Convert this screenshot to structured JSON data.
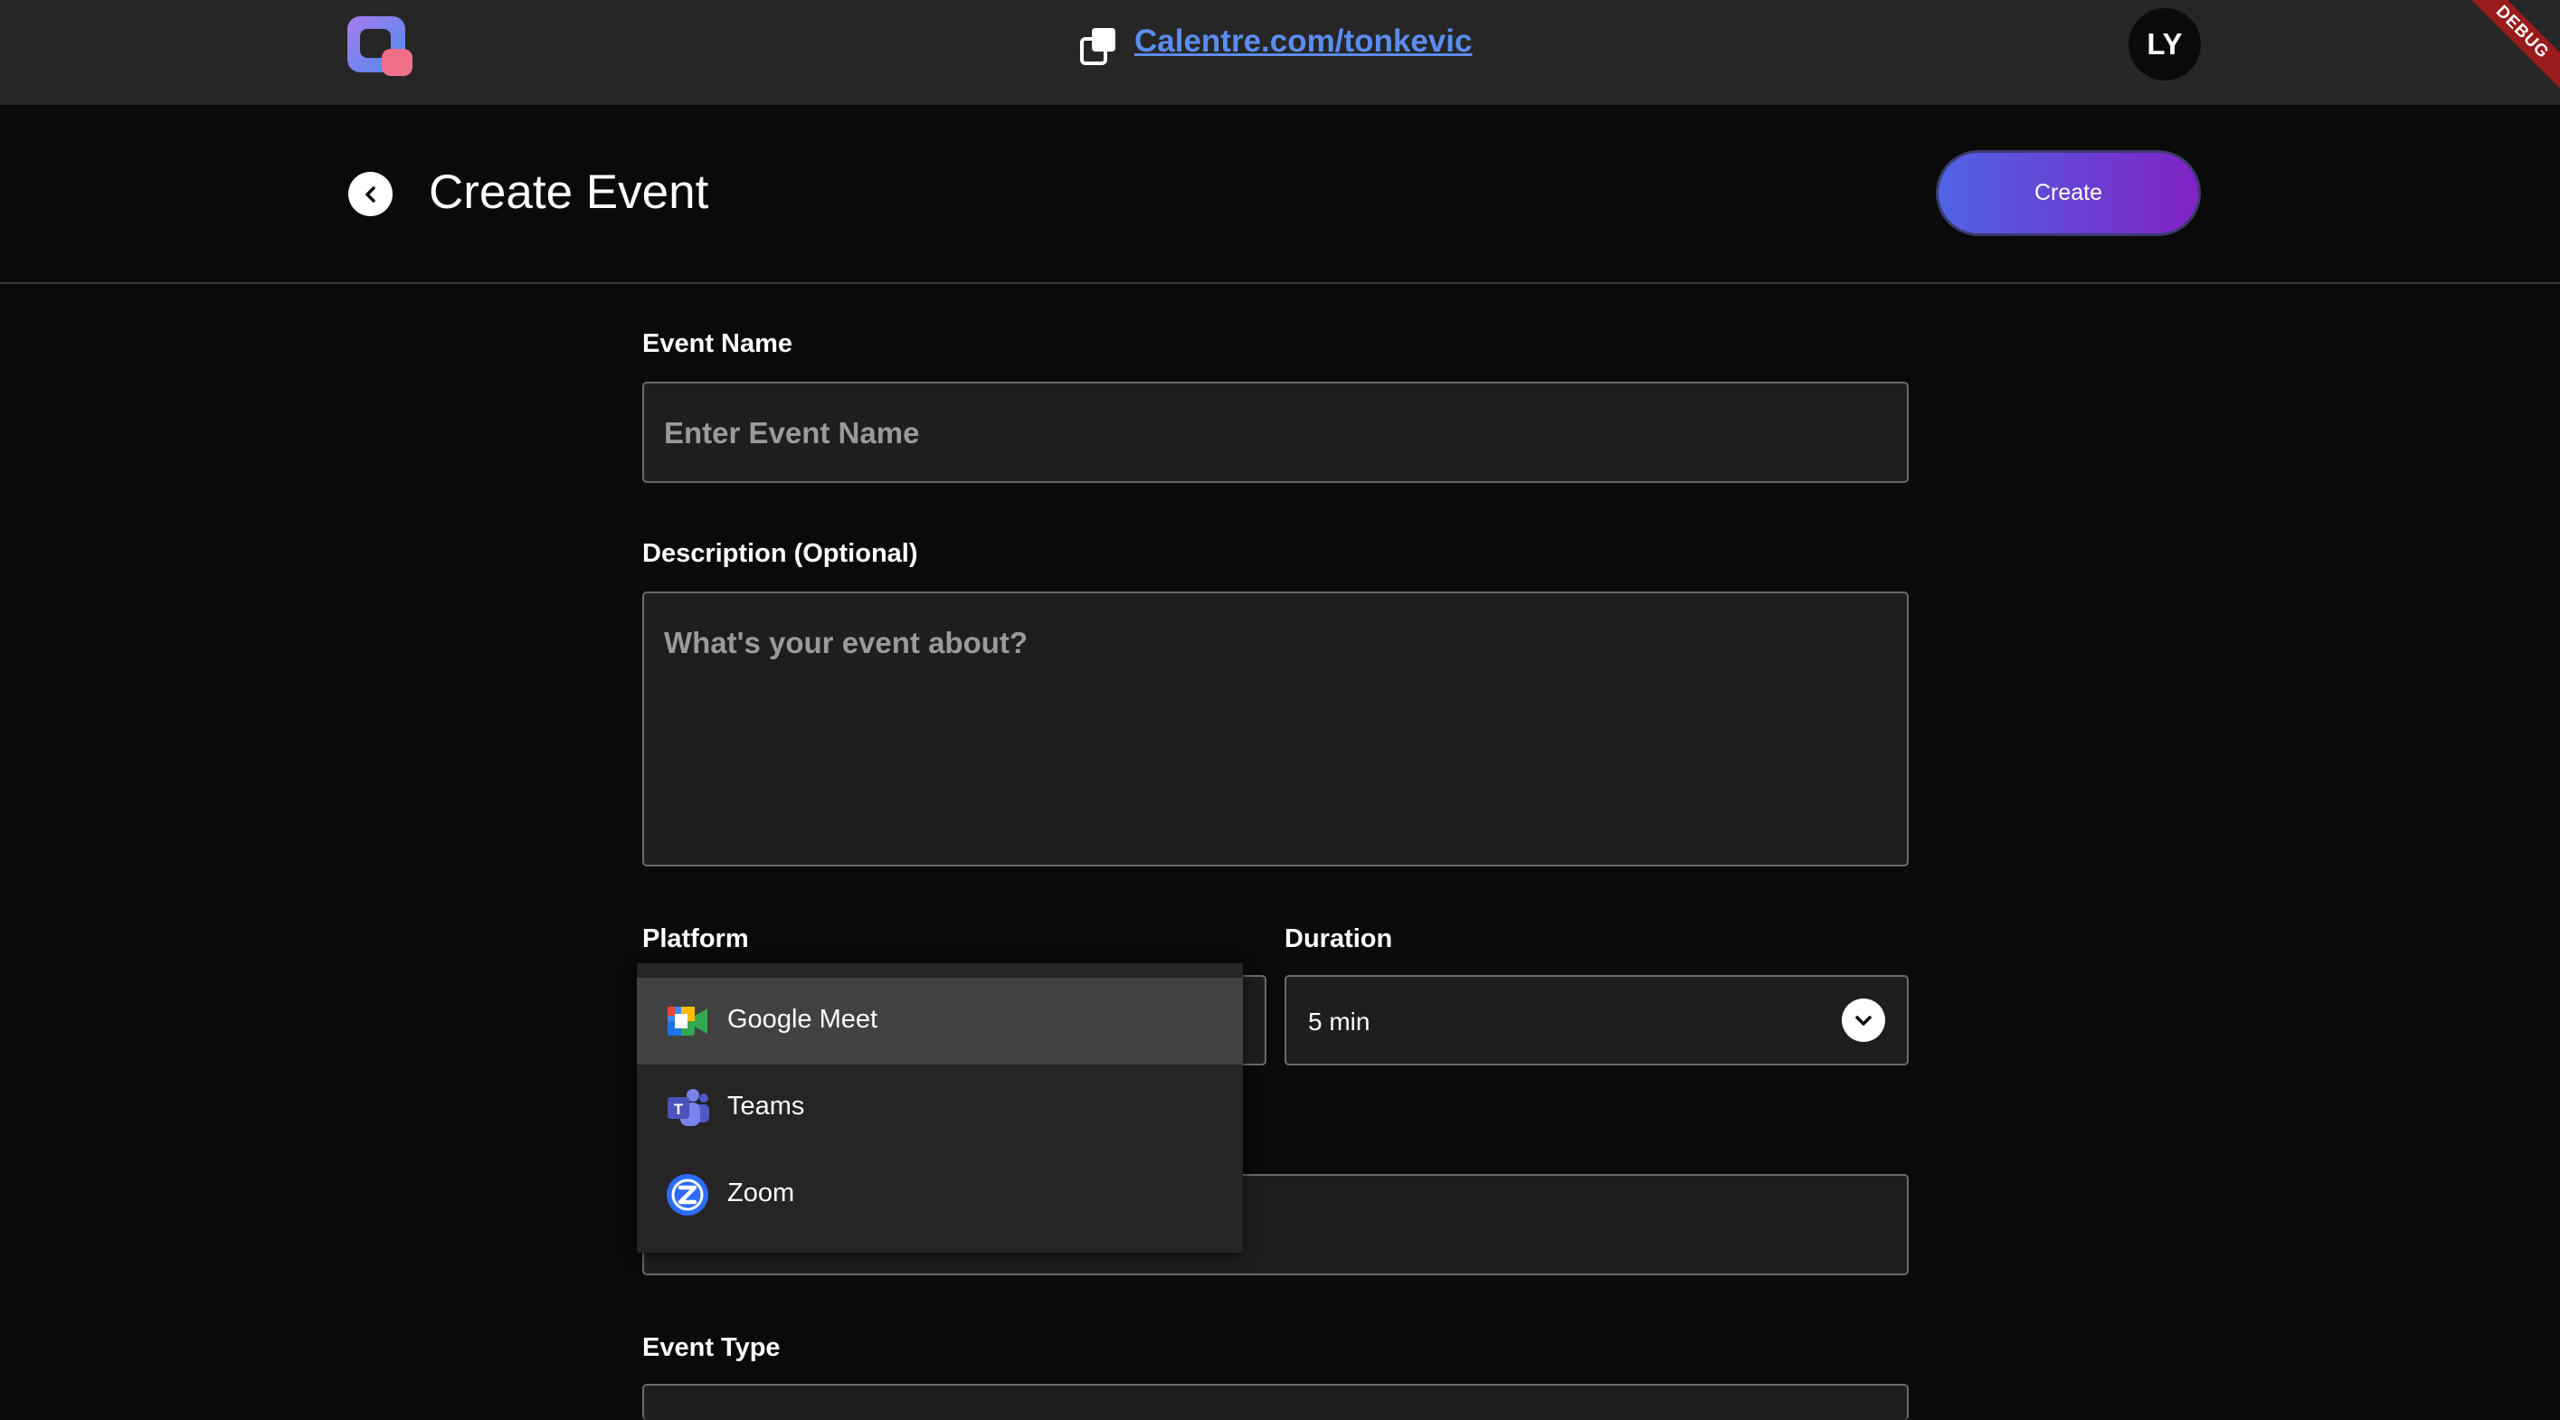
{
  "header": {
    "profile_link": "Calentre.com/tonkevic",
    "avatar_initials": "LY",
    "debug_banner": "DEBUG"
  },
  "toolbar": {
    "title": "Create Event",
    "create_label": "Create"
  },
  "form": {
    "event_name": {
      "label": "Event Name",
      "placeholder": "Enter Event Name",
      "value": ""
    },
    "description": {
      "label": "Description (Optional)",
      "placeholder": "What's your event about?",
      "value": ""
    },
    "platform": {
      "label": "Platform",
      "options": [
        {
          "label": "Google Meet",
          "icon": "google-meet-icon",
          "selected": true
        },
        {
          "label": "Teams",
          "icon": "teams-icon",
          "selected": false
        },
        {
          "label": "Zoom",
          "icon": "zoom-icon",
          "selected": false
        }
      ]
    },
    "duration": {
      "label": "Duration",
      "value": "5 min"
    },
    "event_type": {
      "label": "Event Type"
    }
  },
  "colors": {
    "link": "#5b8cf0",
    "accent_gradient_start": "#4f63e6",
    "accent_gradient_end": "#8022c4",
    "background": "#0a0a0a",
    "topbar": "#262626"
  }
}
